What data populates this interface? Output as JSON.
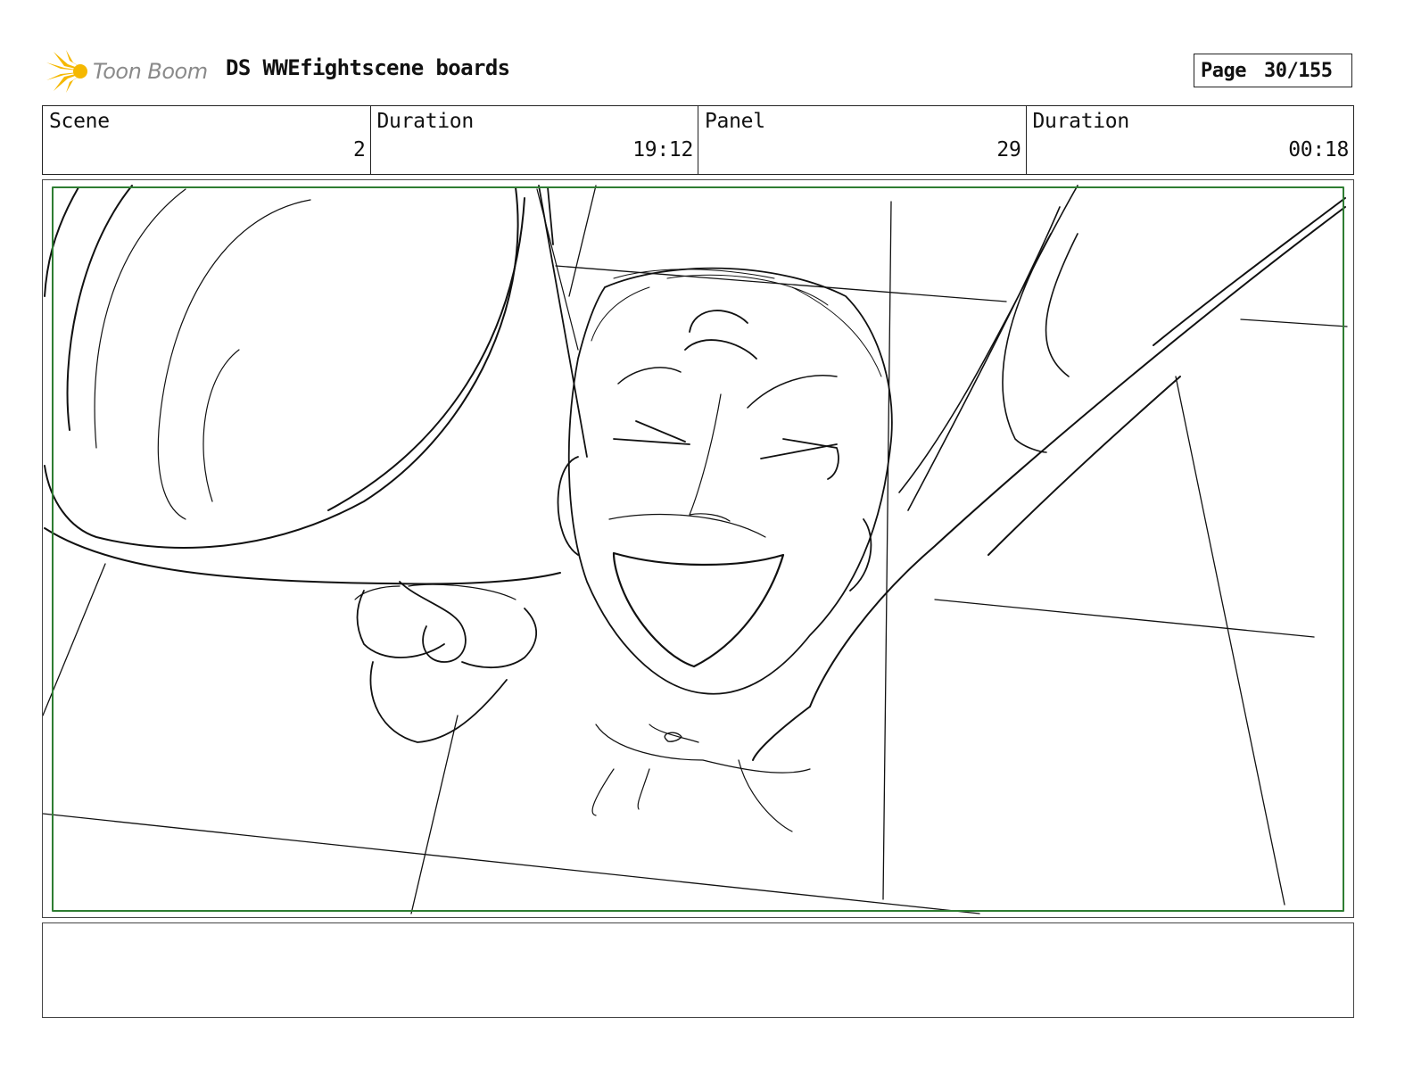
{
  "header": {
    "logo_text": "Toon Boom",
    "title": "DS WWEfightscene boards",
    "page_label": "Page",
    "page_number": "30/155"
  },
  "info": {
    "scene_label": "Scene",
    "scene_value": "2",
    "duration_label": "Duration",
    "duration_value": "19:12",
    "panel_label": "Panel",
    "panel_value": "29",
    "panel_duration_label": "Duration",
    "panel_duration_value": "00:18"
  },
  "colors": {
    "logo_yellow": "#f5b800",
    "safe_frame_green": "#2e7d32"
  },
  "panel": {
    "image": "storyboard-sketch",
    "notes": ""
  }
}
